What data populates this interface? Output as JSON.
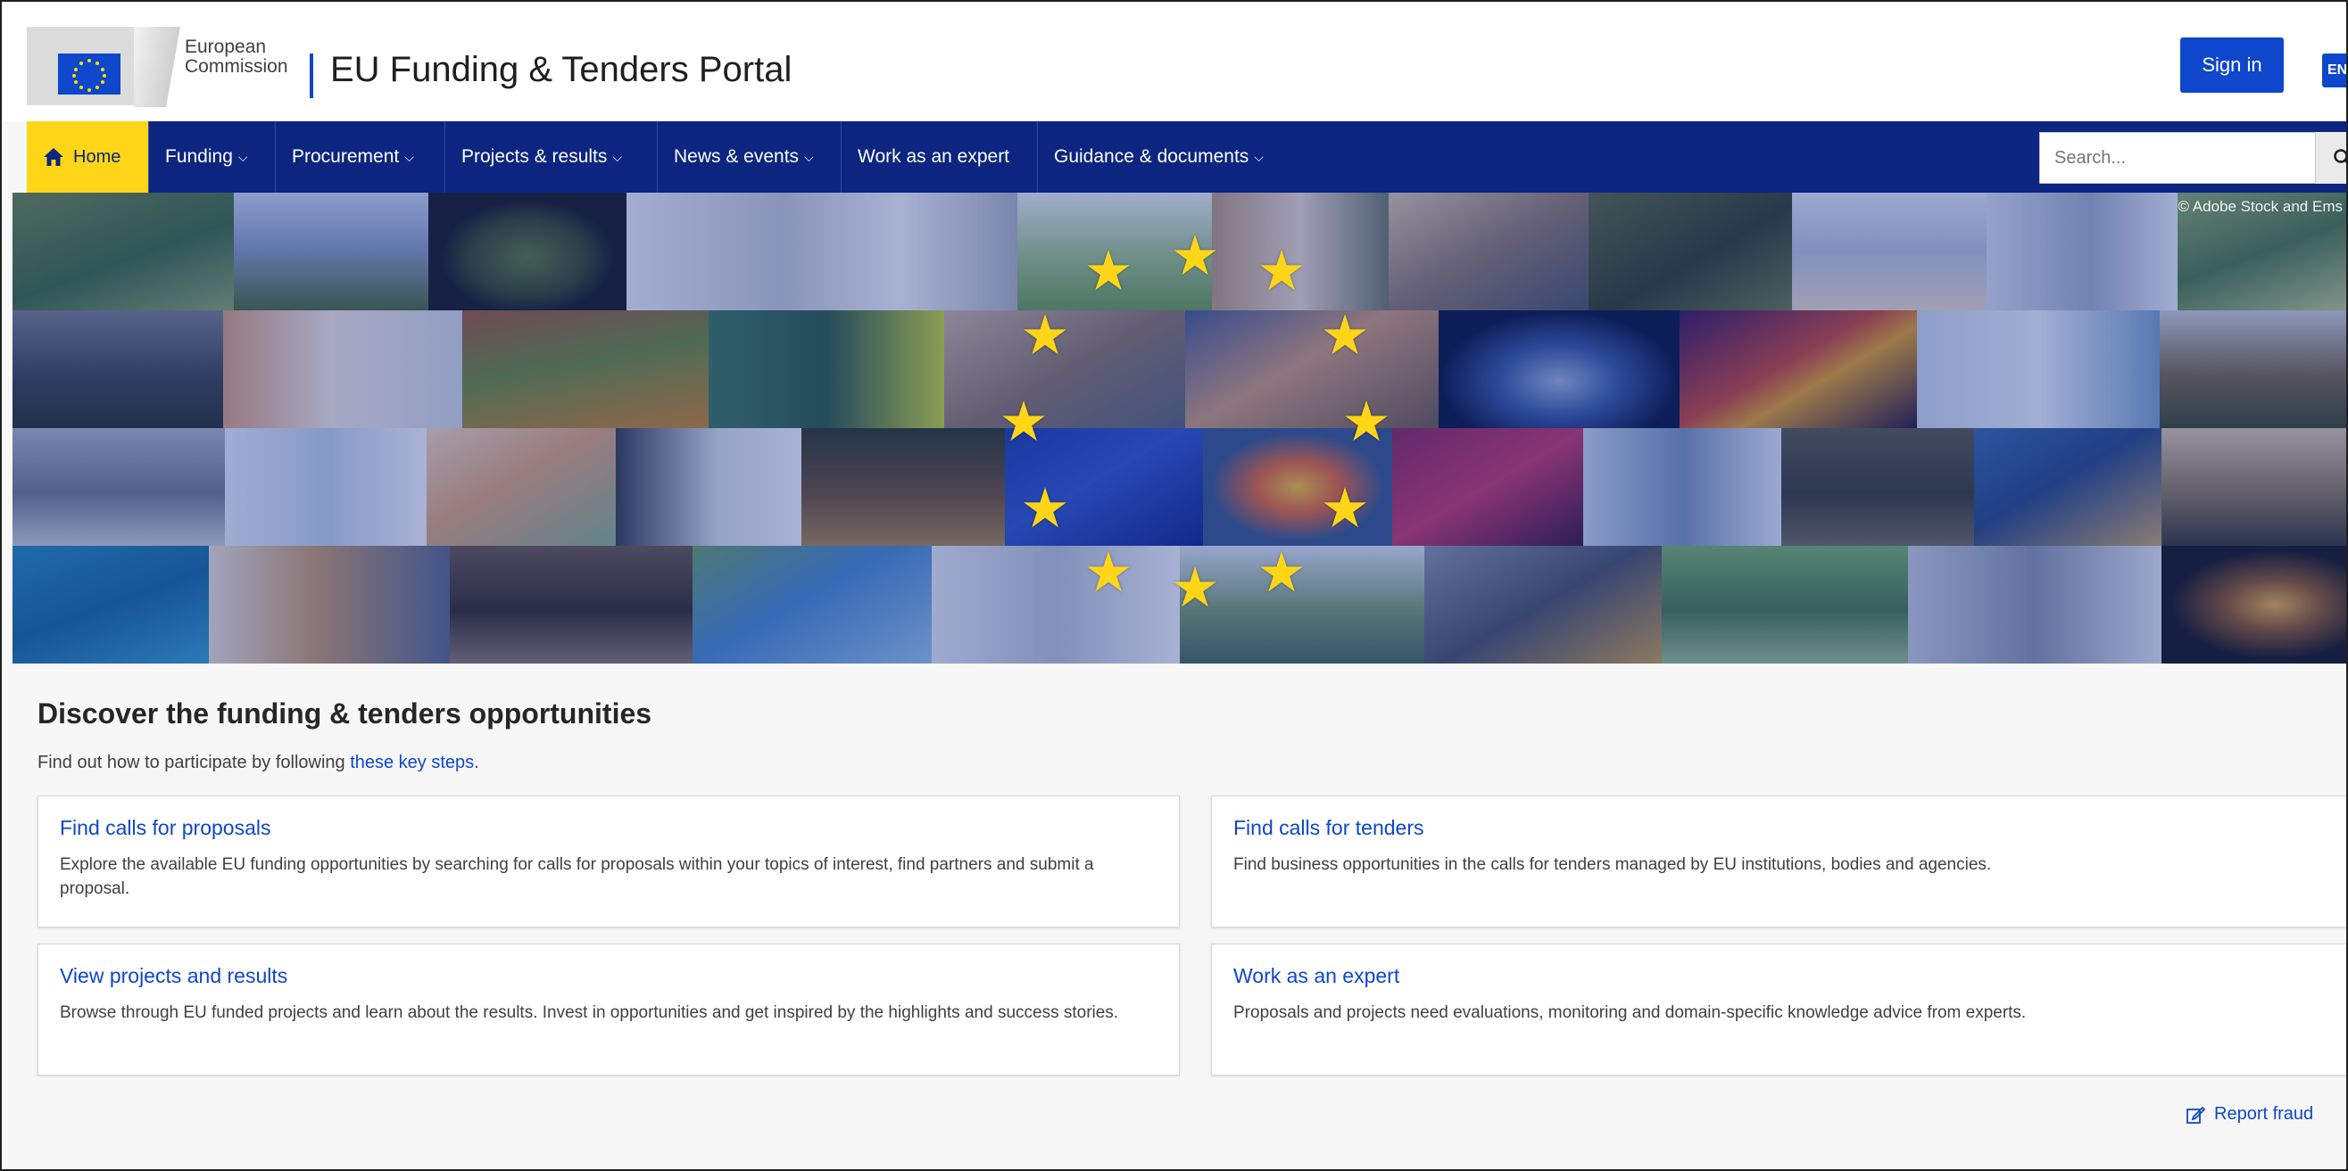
{
  "header": {
    "org_line1": "European",
    "org_line2": "Commission",
    "portal_title": "EU Funding & Tenders Portal",
    "signin_label": "Sign in",
    "language_label": "EN"
  },
  "nav": {
    "home_label": "Home",
    "items": [
      {
        "label": "Funding"
      },
      {
        "label": "Procurement"
      },
      {
        "label": "Projects & results"
      },
      {
        "label": "News & events"
      },
      {
        "label": "Work as an expert"
      },
      {
        "label": "Guidance & documents"
      }
    ],
    "search_placeholder": "Search..."
  },
  "hero": {
    "copyright": "© Adobe Stock and Ems"
  },
  "main": {
    "title": "Discover the funding & tenders opportunities",
    "intro_prefix": "Find out how to participate by following ",
    "intro_link": "these key steps",
    "intro_suffix": ".",
    "cards": [
      {
        "title": "Find calls for proposals",
        "text": "Explore the available EU funding opportunities by searching for calls for proposals within your topics of interest, find partners and submit a proposal."
      },
      {
        "title": "Find calls for tenders",
        "text": "Find business opportunities in the calls for tenders managed by EU institutions, bodies and agencies."
      },
      {
        "title": "View projects and results",
        "text": "Browse through EU funded projects and learn about the results. Invest in opportunities and get inspired by the highlights and success stories."
      },
      {
        "title": "Work as an expert",
        "text": "Proposals and projects need evaluations, monitoring and domain-specific knowledge advice from experts."
      }
    ],
    "report_label": "Report fraud"
  },
  "colors": {
    "primary": "#0e47cb",
    "nav_bg": "#0c2580",
    "home_tab": "#ffd617",
    "star": "#ffd617"
  },
  "icons": {
    "home": "home-icon",
    "search": "search-icon",
    "report": "edit-icon",
    "chevron": "chevron-down-icon"
  }
}
